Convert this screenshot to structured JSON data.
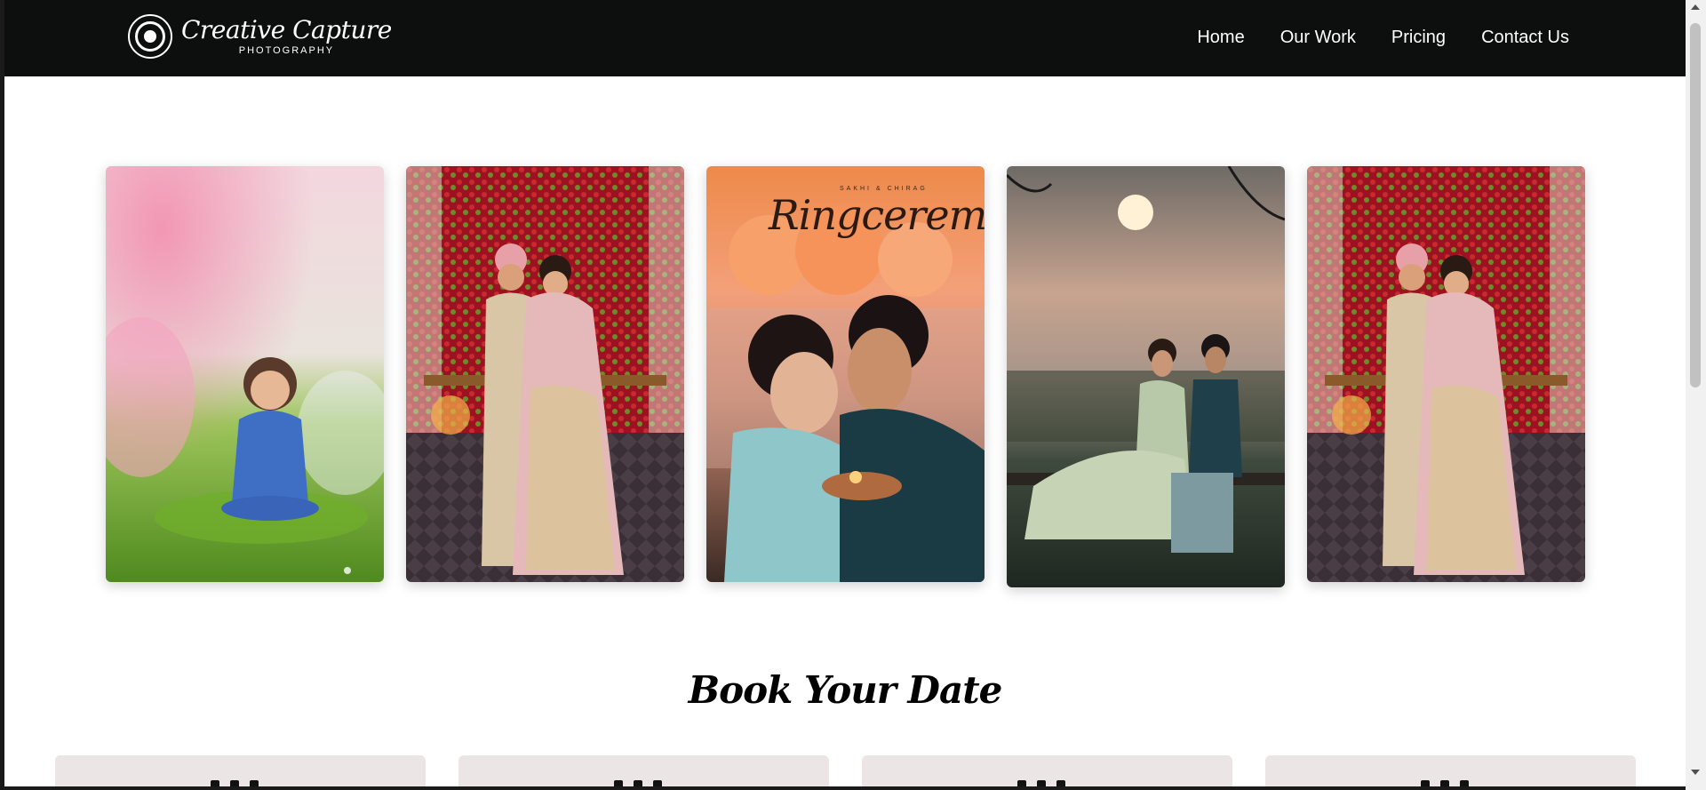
{
  "header": {
    "logo_title": "Creative Capture",
    "logo_subtitle": "PHOTOGRAPHY",
    "nav": [
      {
        "label": "Home"
      },
      {
        "label": "Our Work"
      },
      {
        "label": "Pricing"
      },
      {
        "label": "Contact Us"
      }
    ]
  },
  "gallery": {
    "photos": [
      {
        "alt": "Baby sitting on grass under pink blossoms"
      },
      {
        "alt": "Bride and groom in front of a rose wall"
      },
      {
        "alt": "Couple holding a diya",
        "caption": "Ringceremony",
        "caption_small": "SAKHI & CHIRAG"
      },
      {
        "alt": "Couple sitting on a bench at sunset"
      },
      {
        "alt": "Bride and groom in front of a rose wall"
      }
    ]
  },
  "booking": {
    "title": "Book Your Date"
  },
  "colors": {
    "navbar_bg": "#0d0e0e",
    "card_bg": "#ebe5e5",
    "page_bg": "#ffffff"
  }
}
